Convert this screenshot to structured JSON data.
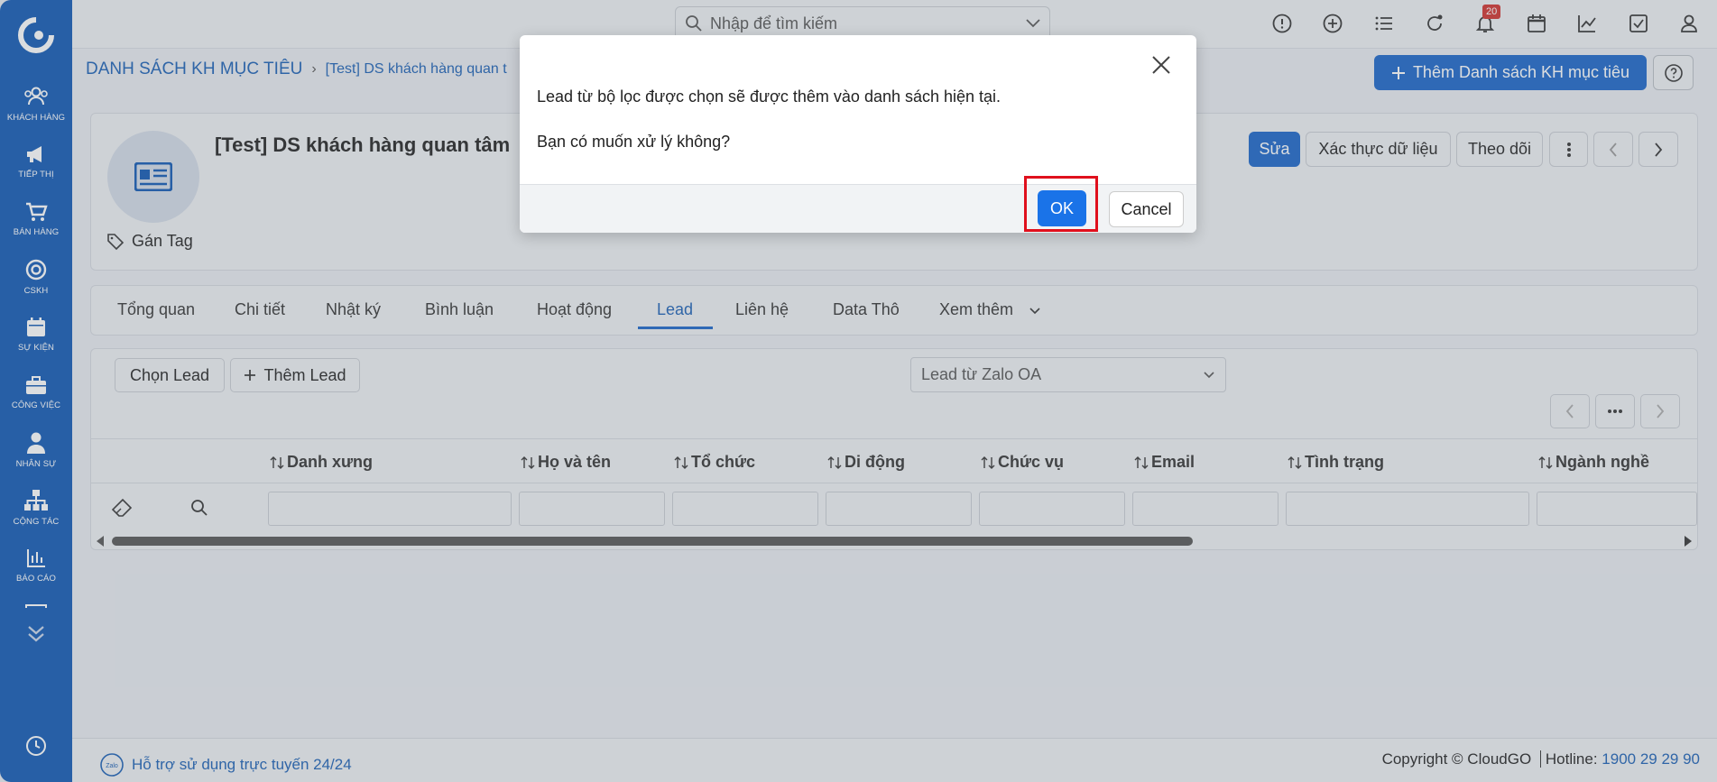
{
  "sidebar": {
    "items": [
      {
        "label": "KHÁCH HÀNG",
        "icon": "users-icon"
      },
      {
        "label": "TIẾP THỊ",
        "icon": "megaphone-icon"
      },
      {
        "label": "BÁN HÀNG",
        "icon": "cart-icon"
      },
      {
        "label": "CSKH",
        "icon": "lifebuoy-icon"
      },
      {
        "label": "SỰ KIỆN",
        "icon": "calendar-icon"
      },
      {
        "label": "CÔNG VIỆC",
        "icon": "briefcase-icon"
      },
      {
        "label": "NHÂN SỰ",
        "icon": "person-icon"
      },
      {
        "label": "CỘNG TÁC",
        "icon": "org-chart-icon"
      },
      {
        "label": "BÁO CÁO",
        "icon": "bar-chart-icon"
      }
    ]
  },
  "topbar": {
    "search_placeholder": "Nhập để tìm kiếm",
    "notification_count": "20"
  },
  "breadcrumb": {
    "module": "DANH SÁCH KH MỤC TIÊU",
    "record": "[Test] DS khách hàng quan t"
  },
  "header": {
    "add_button": "Thêm Danh sách KH mục tiêu",
    "record_title": "[Test] DS khách hàng quan tâm",
    "tag_label": "Gán Tag",
    "edit": "Sửa",
    "validate": "Xác thực dữ liệu",
    "follow": "Theo dõi"
  },
  "tabs": [
    "Tổng quan",
    "Chi tiết",
    "Nhật ký",
    "Bình luận",
    "Hoạt động",
    "Lead",
    "Liên hệ",
    "Data Thô",
    "Xem thêm"
  ],
  "list": {
    "choose_lead": "Chọn Lead",
    "add_lead": "Thêm Lead",
    "filter_value": "Lead từ Zalo OA",
    "columns": [
      "Danh xưng",
      "Họ và tên",
      "Tổ chức",
      "Di động",
      "Chức vụ",
      "Email",
      "Tình trạng",
      "Ngành nghề"
    ]
  },
  "footer": {
    "support": "Hỗ trợ sử dụng trực tuyến 24/24",
    "copyright": "Copyright © CloudGO",
    "hotline_label": "Hotline:",
    "hotline": "1900 29 29 90"
  },
  "modal": {
    "message": "Lead từ bộ lọc được chọn sẽ được thêm vào danh sách hiện tại.",
    "question": "Bạn có muốn xử lý không?",
    "ok": "OK",
    "cancel": "Cancel"
  }
}
